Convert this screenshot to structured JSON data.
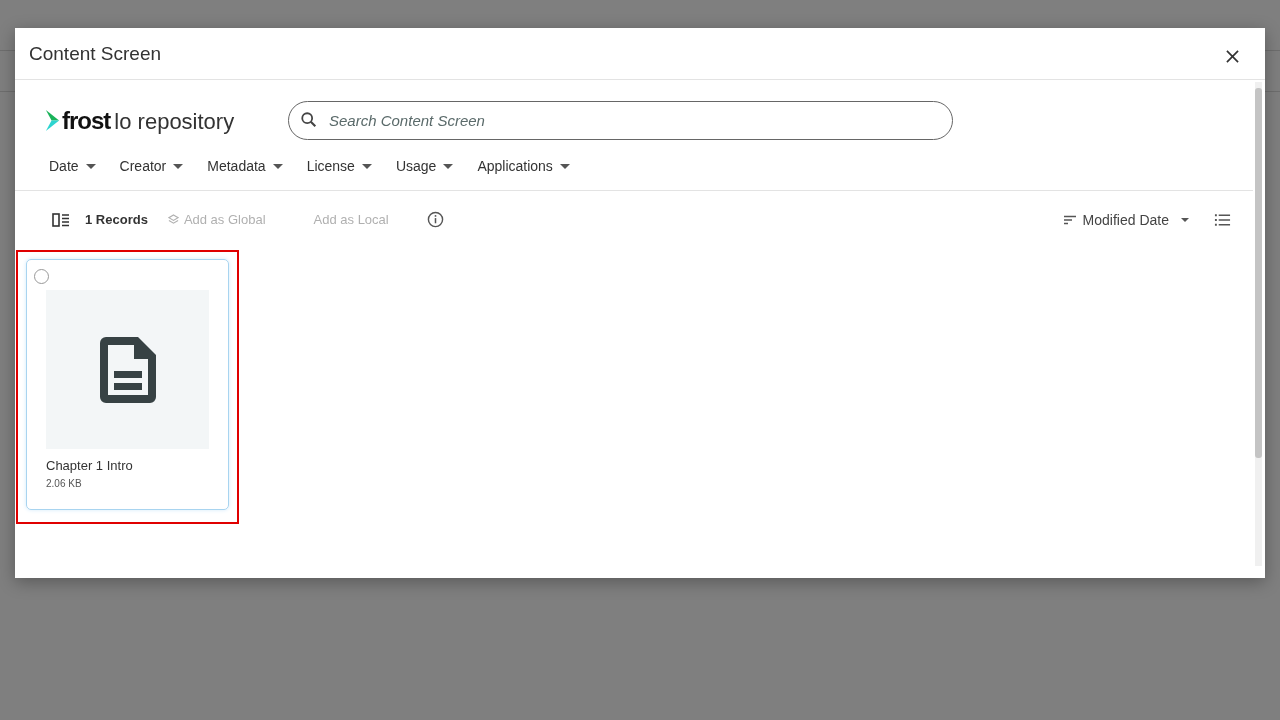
{
  "dialog": {
    "title": "Content Screen",
    "logo": {
      "brand": "frost",
      "product": "lo repository"
    },
    "search": {
      "placeholder": "Search Content Screen"
    },
    "filters": [
      "Date",
      "Creator",
      "Metadata",
      "License",
      "Usage",
      "Applications"
    ],
    "toolbar": {
      "records": "1 Records",
      "actions": [
        {
          "label": "Add as Global",
          "kind": "global",
          "disabled": true
        },
        {
          "label": "Add as Local",
          "kind": "local",
          "disabled": true
        }
      ],
      "sort": "Modified Date"
    },
    "items": [
      {
        "name": "Chapter 1 Intro",
        "size": "2.06 KB",
        "selected": false,
        "highlighted": true
      }
    ]
  }
}
